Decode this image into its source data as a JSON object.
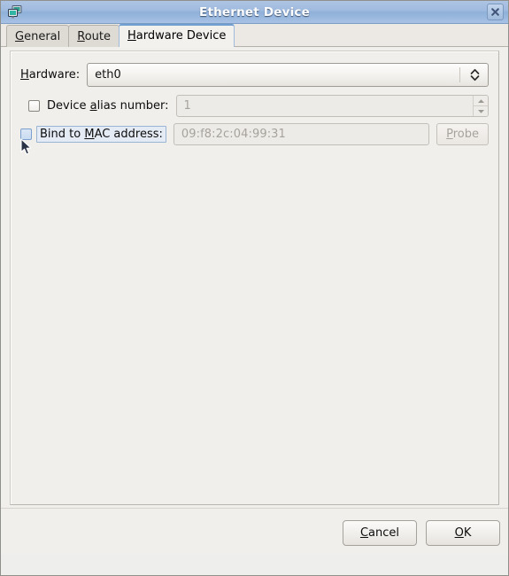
{
  "window": {
    "title": "Ethernet Device",
    "icon": "network-device-icon",
    "close_label": "close-icon"
  },
  "tabs": [
    {
      "id": "general",
      "label": "General",
      "mnemonic": "G",
      "active": false
    },
    {
      "id": "route",
      "label": "Route",
      "mnemonic": "R",
      "active": false
    },
    {
      "id": "hardware",
      "label": "Hardware Device",
      "mnemonic": "H",
      "active": true
    }
  ],
  "form": {
    "hardware": {
      "label": "Hardware:",
      "mnemonic": "H",
      "value": "eth0",
      "enabled": true
    },
    "device_alias": {
      "label": "Device alias number:",
      "mnemonic": "a",
      "checked": false,
      "value": "1",
      "enabled": false
    },
    "bind_mac": {
      "label": "Bind to MAC address:",
      "mnemonic": "M",
      "checked": false,
      "focused": true,
      "hovered": true,
      "value": "09:f8:2c:04:99:31",
      "enabled": false,
      "probe_label": "Probe",
      "probe_mnemonic": "P",
      "probe_enabled": false
    }
  },
  "actions": {
    "cancel_label": "Cancel",
    "cancel_mnemonic": "C",
    "ok_label": "OK",
    "ok_mnemonic": "O"
  },
  "colors": {
    "titlebar_top": "#adc4e4",
    "titlebar_bottom": "#a8c2e4",
    "window_bg": "#eeeeec",
    "panel_bg": "#f1efec",
    "active_tab_accent": "#6f9fd0",
    "disabled_text": "#a6a39d"
  }
}
